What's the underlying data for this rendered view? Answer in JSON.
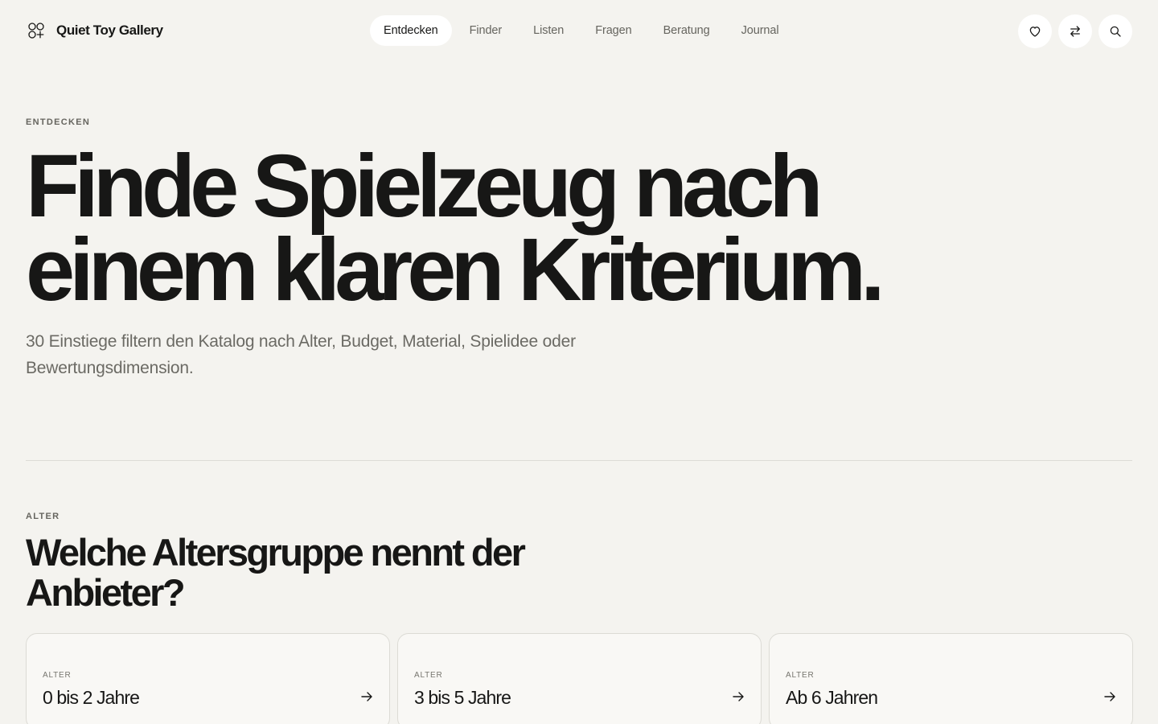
{
  "brand": {
    "name": "Quiet Toy Gallery"
  },
  "nav": {
    "items": [
      {
        "label": "Entdecken",
        "active": true
      },
      {
        "label": "Finder"
      },
      {
        "label": "Listen"
      },
      {
        "label": "Fragen"
      },
      {
        "label": "Beratung"
      },
      {
        "label": "Journal"
      }
    ]
  },
  "actions": {
    "icons": [
      "heart-icon",
      "compare-arrows-icon",
      "search-icon"
    ]
  },
  "hero": {
    "eyebrow": "ENTDECKEN",
    "title_line1": "Finde Spielzeug nach",
    "title_line2": "einem klaren Kriterium.",
    "lead_line1": "30 Einstiege filtern den Katalog nach Alter, Budget, Material, Spielidee oder",
    "lead_line2": "Bewertungsdimension."
  },
  "section": {
    "eyebrow": "ALTER",
    "title_line1": "Welche Altersgruppe nennt der",
    "title_line2": "Anbieter?",
    "cards": [
      {
        "label": "ALTER",
        "title": "0 bis 2 Jahre"
      },
      {
        "label": "ALTER",
        "title": "3 bis 5 Jahre"
      },
      {
        "label": "ALTER",
        "title": "Ab 6 Jahren"
      }
    ]
  },
  "colors": {
    "background": "#f4f3ef",
    "text": "#171716",
    "muted": "#6b6a64",
    "surface": "#ffffff",
    "border": "#dcdbd5"
  }
}
